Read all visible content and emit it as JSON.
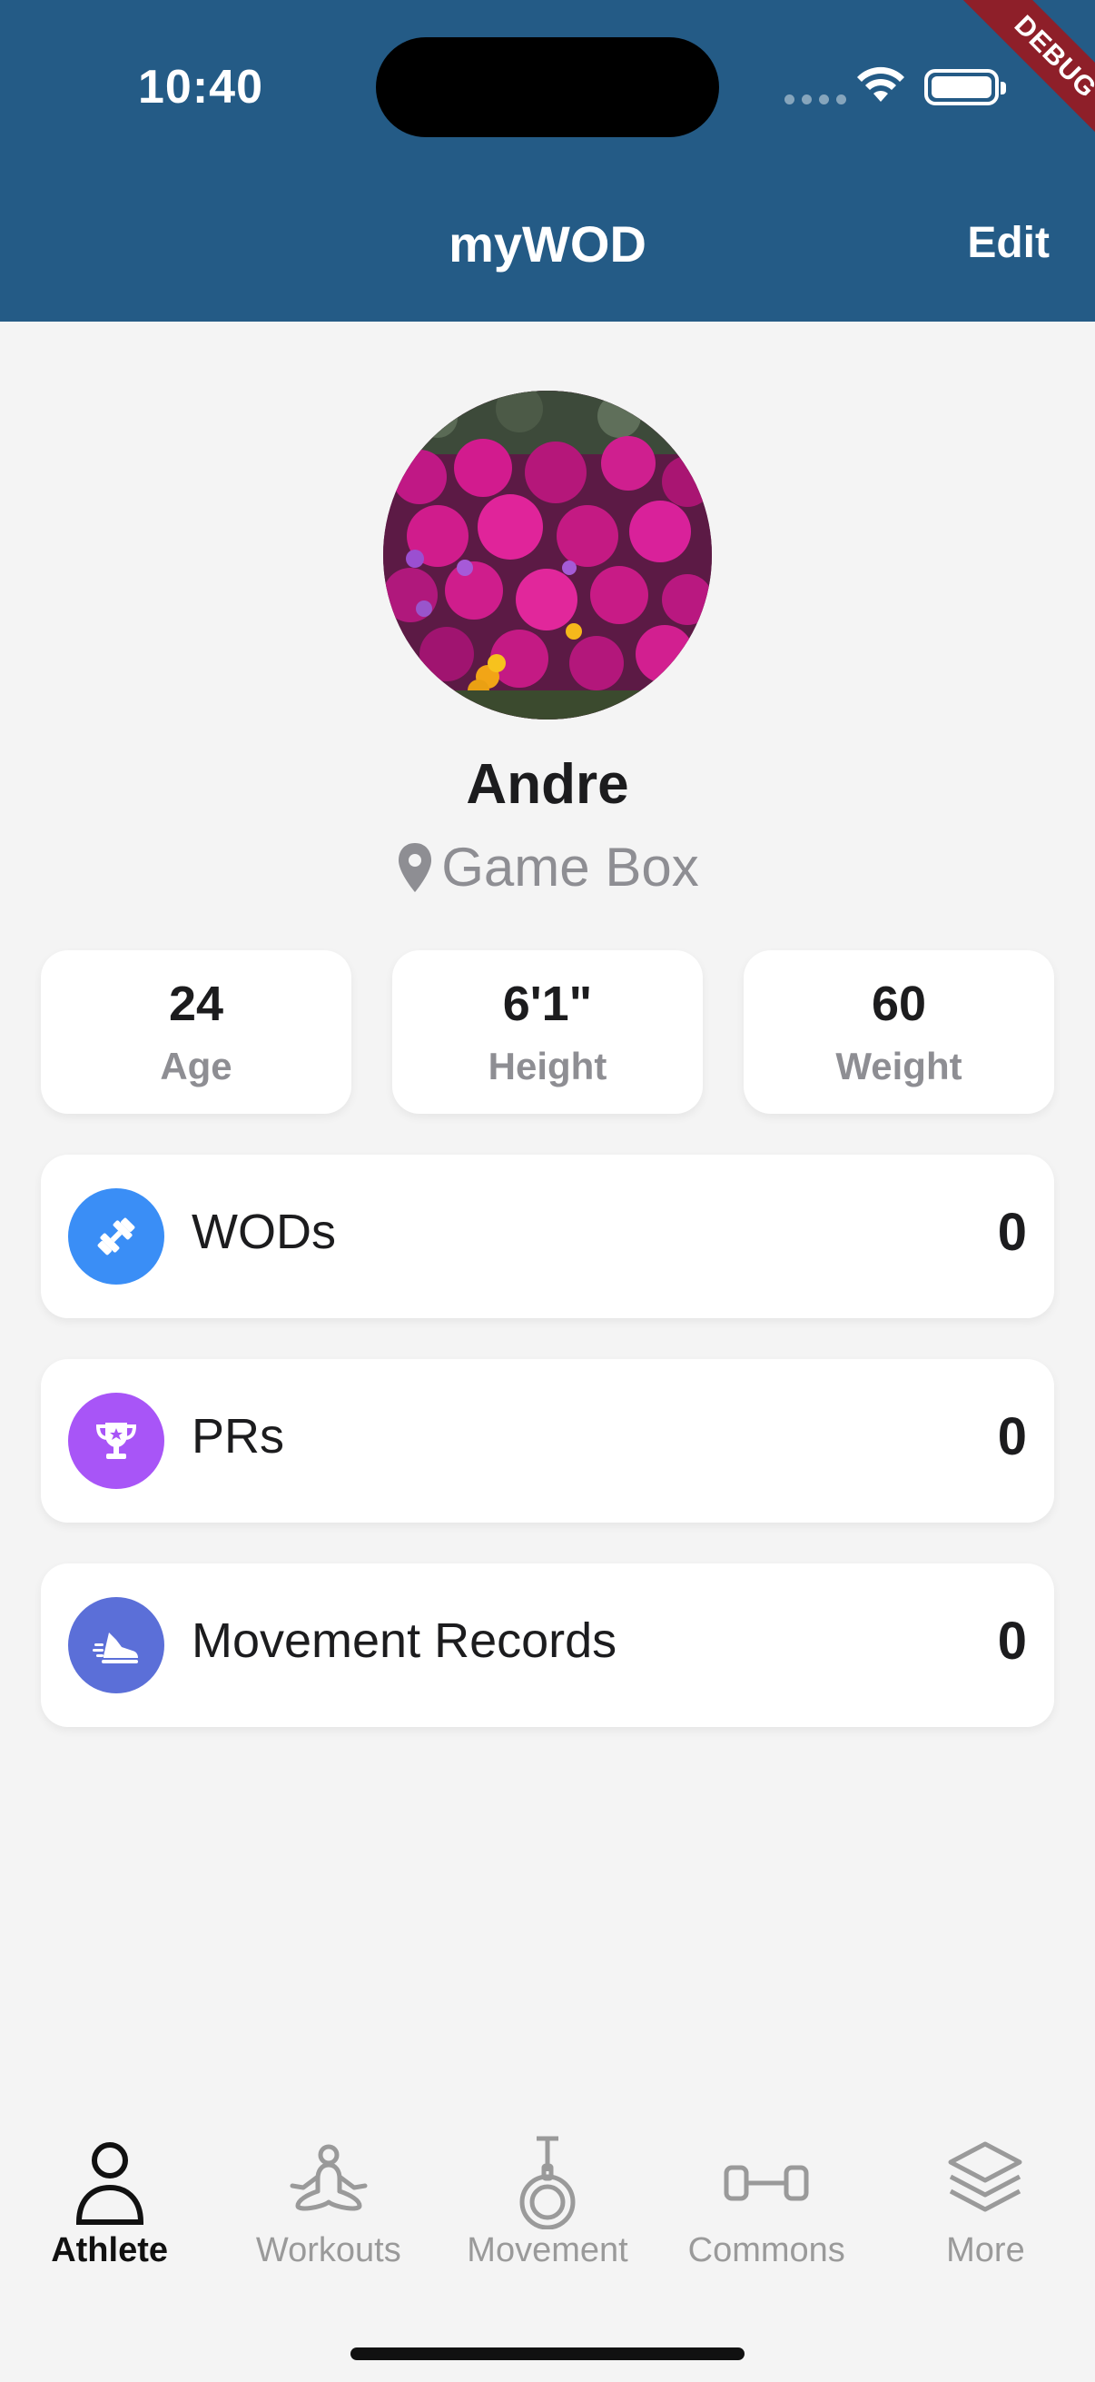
{
  "status_bar": {
    "time": "10:40"
  },
  "debug_banner": "DEBUG",
  "header": {
    "title": "myWOD",
    "edit_label": "Edit"
  },
  "profile": {
    "name": "Andre",
    "location": "Game Box"
  },
  "stats": [
    {
      "value": "24",
      "label": "Age"
    },
    {
      "value": "6'1\"",
      "label": "Height"
    },
    {
      "value": "60",
      "label": "Weight"
    }
  ],
  "records": [
    {
      "label": "WODs",
      "count": "0",
      "icon": "dumbbell-icon",
      "color": "#3a8ef6"
    },
    {
      "label": "PRs",
      "count": "0",
      "icon": "trophy-icon",
      "color": "#a855f7"
    },
    {
      "label": "Movement Records",
      "count": "0",
      "icon": "running-shoe-icon",
      "color": "#5b6fd8"
    }
  ],
  "nav": [
    {
      "label": "Athlete",
      "icon": "person-icon",
      "active": true
    },
    {
      "label": "Workouts",
      "icon": "meditation-figure-icon",
      "active": false
    },
    {
      "label": "Movement",
      "icon": "gymnastic-ring-icon",
      "active": false
    },
    {
      "label": "Commons",
      "icon": "dumbbell-outline-icon",
      "active": false
    },
    {
      "label": "More",
      "icon": "layers-icon",
      "active": false
    }
  ],
  "colors": {
    "header_bg": "#245b86",
    "active_nav": "#111111",
    "inactive_nav": "#9a9a9a"
  }
}
